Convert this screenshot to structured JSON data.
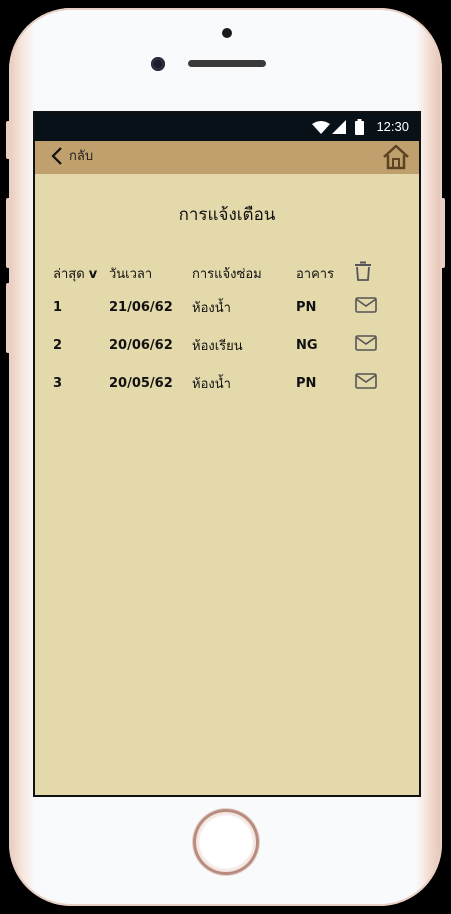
{
  "statusbar": {
    "time": "12:30",
    "wifi_icon": "wifi-icon",
    "signal_icon": "signal-icon",
    "battery_icon": "battery-icon"
  },
  "appbar": {
    "back_label": "กลับ",
    "back_icon": "chevron-left-icon",
    "home_icon": "home-icon",
    "color": "#c0a06c"
  },
  "page": {
    "title": "การแจ้งเตือน",
    "background": "#e4d9aa"
  },
  "table": {
    "headers": {
      "latest": "ล่าสุด",
      "sort_indicator": "v",
      "datetime": "วันเวลา",
      "report": "การแจ้งซ่อม",
      "building": "อาคาร",
      "delete_icon": "trash-icon"
    },
    "rows": [
      {
        "no": "1",
        "date": "21/06/62",
        "room": "ห้องน้ำ",
        "building": "PN",
        "icon": "mail-icon"
      },
      {
        "no": "2",
        "date": "20/06/62",
        "room": "ห้องเรียน",
        "building": "NG",
        "icon": "mail-icon"
      },
      {
        "no": "3",
        "date": "20/05/62",
        "room": "ห้องน้ำ",
        "building": "PN",
        "icon": "mail-icon"
      }
    ]
  }
}
